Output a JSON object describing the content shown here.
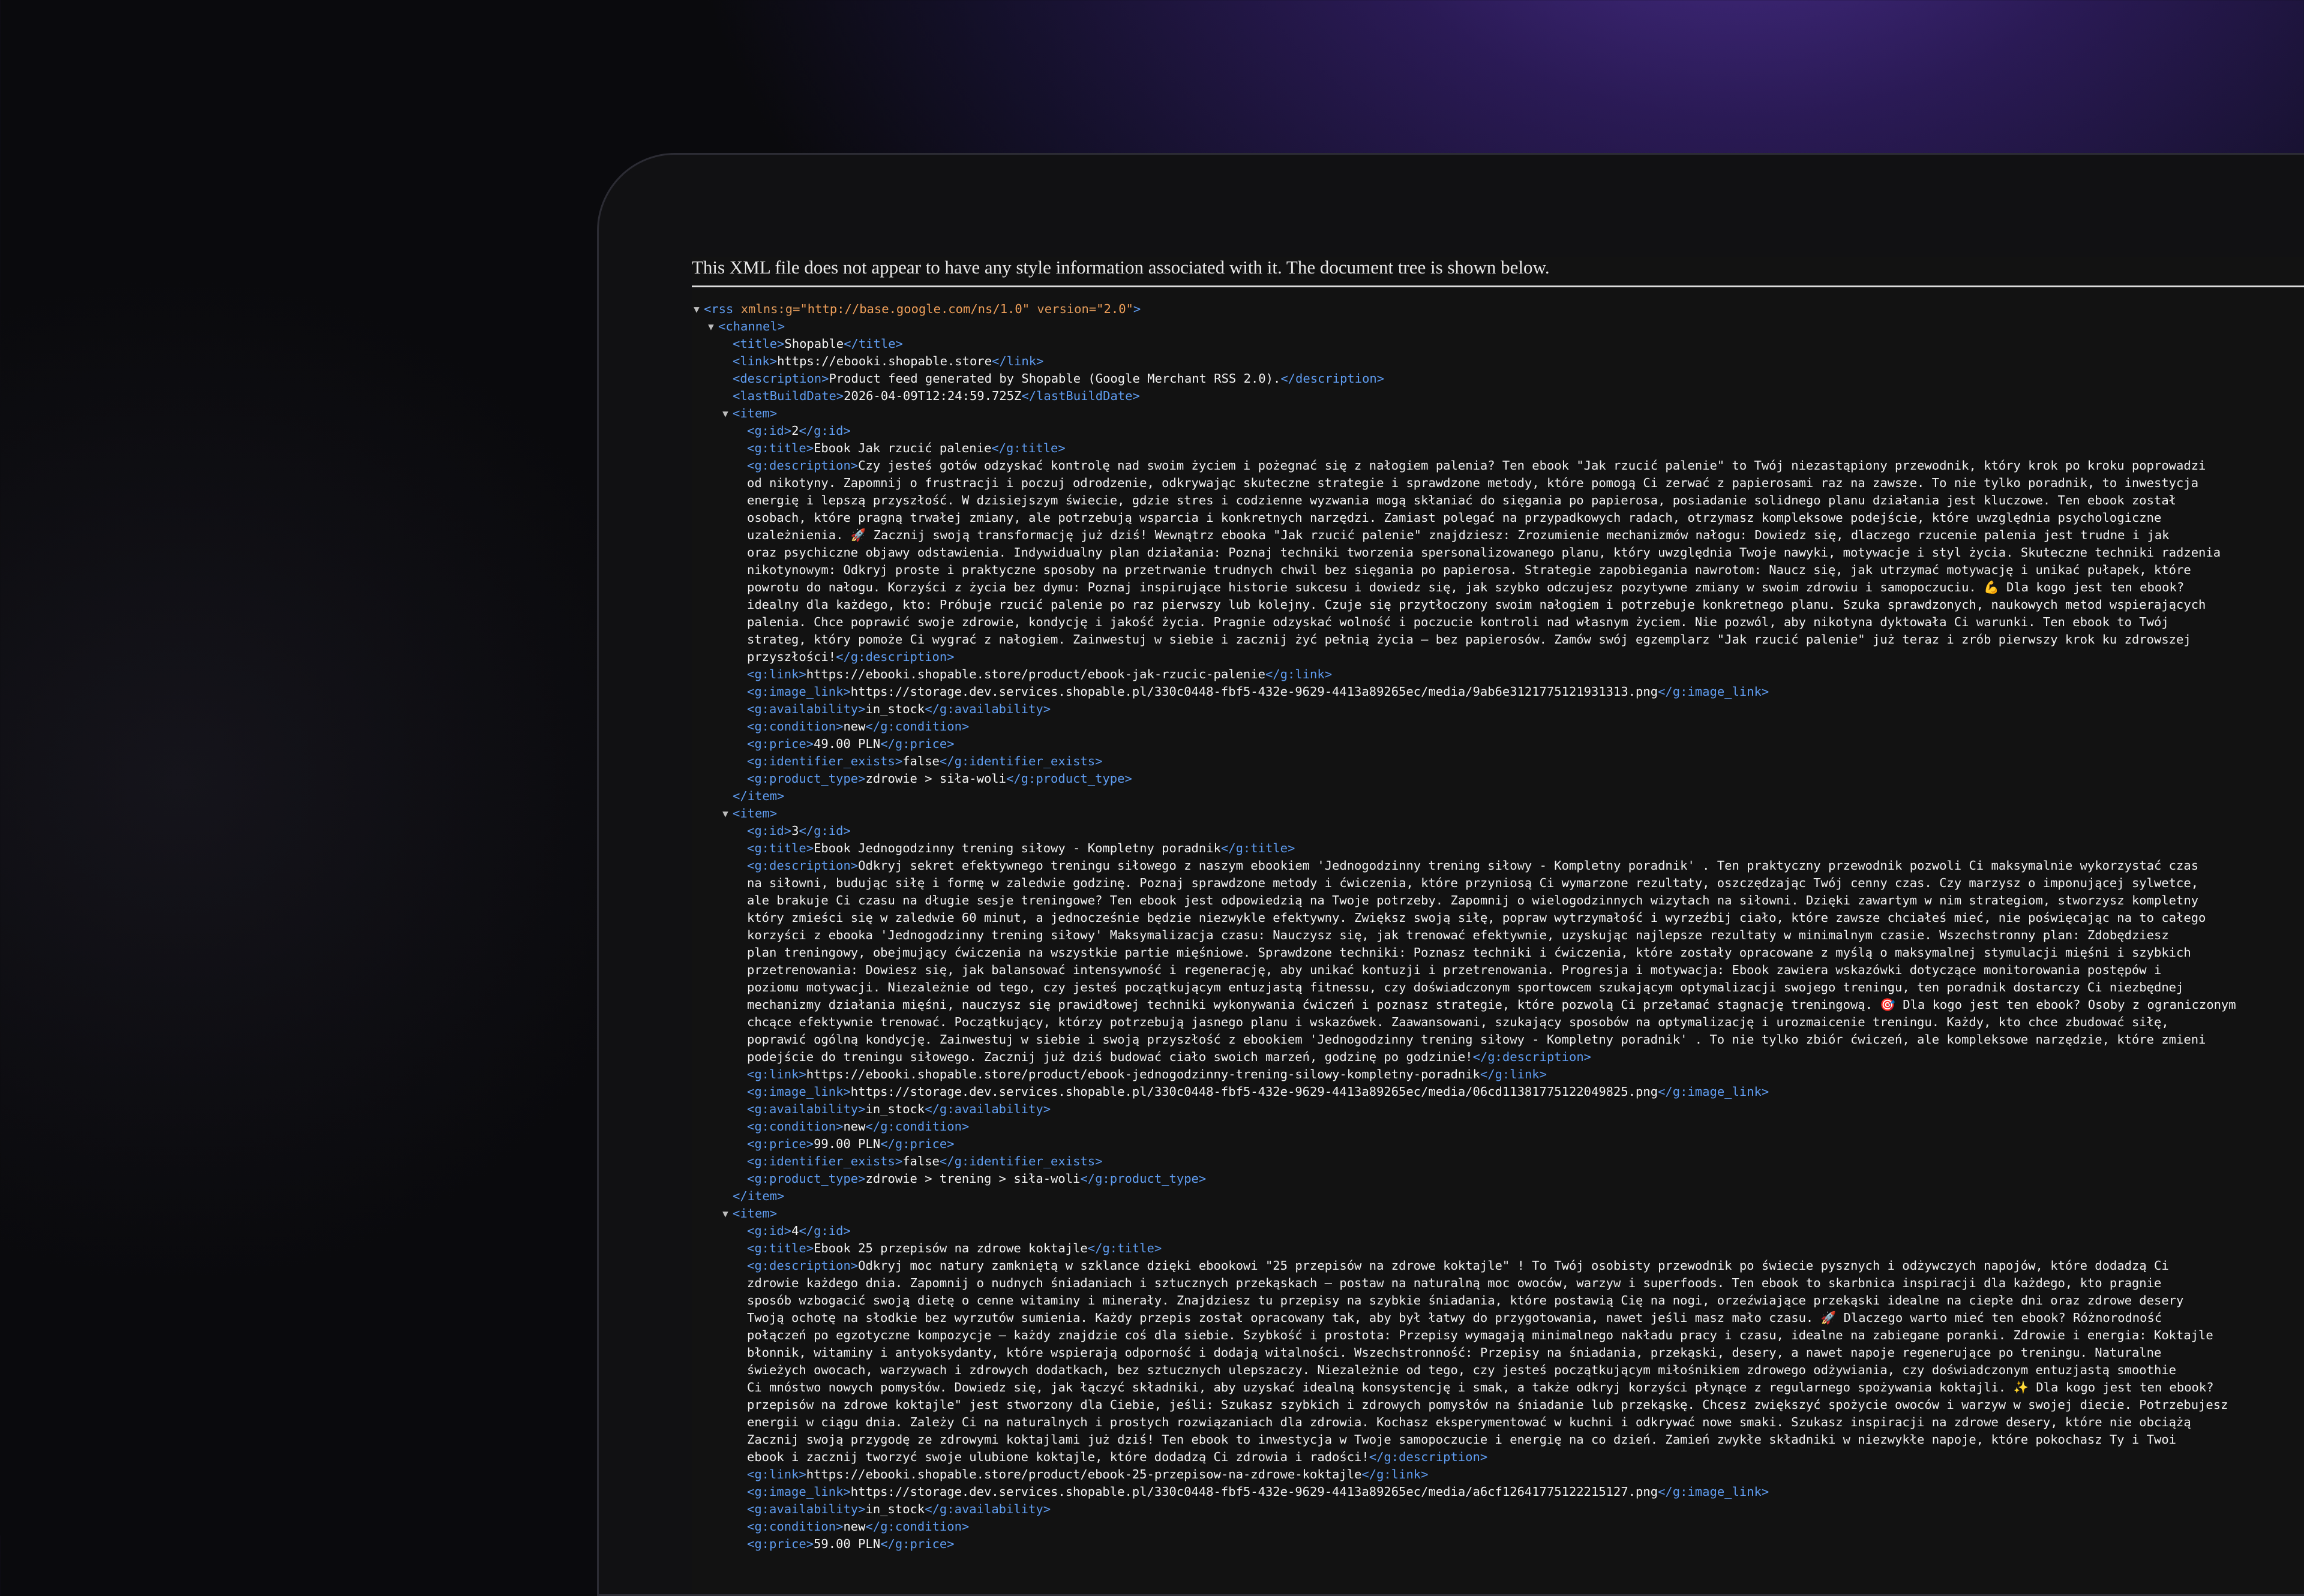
{
  "banner": "This XML file does not appear to have any style information associated with it. The document tree is shown below.",
  "rss": {
    "open": "<rss xmlns:g=\"http://base.google.com/ns/1.0\" version=\"2.0\">",
    "channel_open": "<channel>",
    "title": "Shopable",
    "link": "https://ebooki.shopable.store",
    "description": "Product feed generated by Shopable (Google Merchant RSS 2.0).",
    "lastBuildDate": "2026-04-09T12:24:59.725Z"
  },
  "items": [
    {
      "id": "2",
      "title": "Ebook Jak rzucić palenie",
      "description_lines": [
        "Czy jesteś gotów odzyskać kontrolę nad swoim życiem i pożegnać się z nałogiem palenia? Ten ebook \"Jak rzucić palenie\" to Twój niezastąpiony przewodnik, który krok po kroku poprowadzi",
        "od nikotyny. Zapomnij o frustracji i poczuj odrodzenie, odkrywając skuteczne strategie i sprawdzone metody, które pomogą Ci zerwać z papierosami raz na zawsze. To nie tylko poradnik, to inwestycja",
        "energię i lepszą przyszłość. W dzisiejszym świecie, gdzie stres i codzienne wyzwania mogą skłaniać do sięgania po papierosa, posiadanie solidnego planu działania jest kluczowe. Ten ebook został",
        "osobach, które pragną trwałej zmiany, ale potrzebują wsparcia i konkretnych narzędzi. Zamiast polegać na przypadkowych radach, otrzymasz kompleksowe podejście, które uwzględnia psychologiczne",
        "uzależnienia. 🚀 Zacznij swoją transformację już dziś! Wewnątrz ebooka \"Jak rzucić palenie\" znajdziesz: Zrozumienie mechanizmów nałogu: Dowiedz się, dlaczego rzucenie palenia jest trudne i jak",
        "oraz psychiczne objawy odstawienia. Indywidualny plan działania: Poznaj techniki tworzenia spersonalizowanego planu, który uwzględnia Twoje nawyki, motywacje i styl życia. Skuteczne techniki radzenia",
        "nikotynowym: Odkryj proste i praktyczne sposoby na przetrwanie trudnych chwil bez sięgania po papierosa. Strategie zapobiegania nawrotom: Naucz się, jak utrzymać motywację i unikać pułapek, które",
        "powrotu do nałogu. Korzyści z życia bez dymu: Poznaj inspirujące historie sukcesu i dowiedz się, jak szybko odczujesz pozytywne zmiany w swoim zdrowiu i samopoczuciu. 💪 Dla kogo jest ten ebook?",
        "idealny dla każdego, kto: Próbuje rzucić palenie po raz pierwszy lub kolejny. Czuje się przytłoczony swoim nałogiem i potrzebuje konkretnego planu. Szuka sprawdzonych, naukowych metod wspierających",
        "palenia. Chce poprawić swoje zdrowie, kondycję i jakość życia. Pragnie odzyskać wolność i poczucie kontroli nad własnym życiem. Nie pozwól, aby nikotyna dyktowała Ci warunki. Ten ebook to Twój",
        "strateg, który pomoże Ci wygrać z nałogiem. Zainwestuj w siebie i zacznij żyć pełnią życia – bez papierosów. Zamów swój egzemplarz \"Jak rzucić palenie\" już teraz i zrób pierwszy krok ku zdrowszej",
        "przyszłości!"
      ],
      "link": "https://ebooki.shopable.store/product/ebook-jak-rzucic-palenie",
      "image_link": "https://storage.dev.services.shopable.pl/330c0448-fbf5-432e-9629-4413a89265ec/media/9ab6e3121775121931313.png",
      "availability": "in_stock",
      "condition": "new",
      "price": "49.00 PLN",
      "identifier_exists": "false",
      "product_type": "zdrowie > siła-woli"
    },
    {
      "id": "3",
      "title": "Ebook Jednogodzinny trening siłowy - Kompletny poradnik",
      "description_lines": [
        "Odkryj sekret efektywnego treningu siłowego z naszym ebookiem 'Jednogodzinny trening siłowy - Kompletny poradnik' . Ten praktyczny przewodnik pozwoli Ci maksymalnie wykorzystać czas",
        "na siłowni, budując siłę i formę w zaledwie godzinę. Poznaj sprawdzone metody i ćwiczenia, które przyniosą Ci wymarzone rezultaty, oszczędzając Twój cenny czas. Czy marzysz o imponującej sylwetce,",
        "ale brakuje Ci czasu na długie sesje treningowe? Ten ebook jest odpowiedzią na Twoje potrzeby. Zapomnij o wielogodzinnych wizytach na siłowni. Dzięki zawartym w nim strategiom, stworzysz kompletny",
        "który zmieści się w zaledwie 60 minut, a jednocześnie będzie niezwykle efektywny. Zwiększ swoją siłę, popraw wytrzymałość i wyrzeźbij ciało, które zawsze chciałeś mieć, nie poświęcając na to całego",
        "korzyści z ebooka 'Jednogodzinny trening siłowy' Maksymalizacja czasu: Nauczysz się, jak trenować efektywnie, uzyskując najlepsze rezultaty w minimalnym czasie. Wszechstronny plan: Zdobędziesz",
        "plan treningowy, obejmujący ćwiczenia na wszystkie partie mięśniowe. Sprawdzone techniki: Poznasz techniki i ćwiczenia, które zostały opracowane z myślą o maksymalnej stymulacji mięśni i szybkich",
        "przetrenowania: Dowiesz się, jak balansować intensywność i regenerację, aby unikać kontuzji i przetrenowania. Progresja i motywacja: Ebook zawiera wskazówki dotyczące monitorowania postępów i",
        "poziomu motywacji. Niezależnie od tego, czy jesteś początkującym entuzjastą fitnessu, czy doświadczonym sportowcem szukającym optymalizacji swojego treningu, ten poradnik dostarczy Ci niezbędnej",
        "mechanizmy działania mięśni, nauczysz się prawidłowej techniki wykonywania ćwiczeń i poznasz strategie, które pozwolą Ci przełamać stagnację treningową. 🎯 Dla kogo jest ten ebook? Osoby z ograniczonym",
        "chcące efektywnie trenować. Początkujący, którzy potrzebują jasnego planu i wskazówek. Zaawansowani, szukający sposobów na optymalizację i urozmaicenie treningu. Każdy, kto chce zbudować siłę,",
        "poprawić ogólną kondycję. Zainwestuj w siebie i swoją przyszłość z ebookiem 'Jednogodzinny trening siłowy - Kompletny poradnik' . To nie tylko zbiór ćwiczeń, ale kompleksowe narzędzie, które zmieni",
        "podejście do treningu siłowego. Zacznij już dziś budować ciało swoich marzeń, godzinę po godzinie!"
      ],
      "link": "https://ebooki.shopable.store/product/ebook-jednogodzinny-trening-silowy-kompletny-poradnik",
      "image_link": "https://storage.dev.services.shopable.pl/330c0448-fbf5-432e-9629-4413a89265ec/media/06cd11381775122049825.png",
      "availability": "in_stock",
      "condition": "new",
      "price": "99.00 PLN",
      "identifier_exists": "false",
      "product_type": "zdrowie > trening > siła-woli"
    },
    {
      "id": "4",
      "title": "Ebook 25 przepisów na zdrowe koktajle",
      "description_lines": [
        "Odkryj moc natury zamkniętą w szklance dzięki ebookowi \"25 przepisów na zdrowe koktajle\" ! To Twój osobisty przewodnik po świecie pysznych i odżywczych napojów, które dodadzą Ci",
        "zdrowie każdego dnia. Zapomnij o nudnych śniadaniach i sztucznych przekąskach – postaw na naturalną moc owoców, warzyw i superfoods. Ten ebook to skarbnica inspiracji dla każdego, kto pragnie",
        "sposób wzbogacić swoją dietę o cenne witaminy i minerały. Znajdziesz tu przepisy na szybkie śniadania, które postawią Cię na nogi, orzeźwiające przekąski idealne na ciepłe dni oraz zdrowe desery",
        "Twoją ochotę na słodkie bez wyrzutów sumienia. Każdy przepis został opracowany tak, aby był łatwy do przygotowania, nawet jeśli masz mało czasu. 🚀 Dlaczego warto mieć ten ebook? Różnorodność",
        "połączeń po egzotyczne kompozycje – każdy znajdzie coś dla siebie. Szybkość i prostota: Przepisy wymagają minimalnego nakładu pracy i czasu, idealne na zabiegane poranki. Zdrowie i energia: Koktajle",
        "błonnik, witaminy i antyoksydanty, które wspierają odporność i dodają witalności. Wszechstronność: Przepisy na śniadania, przekąski, desery, a nawet napoje regenerujące po treningu. Naturalne",
        "świeżych owocach, warzywach i zdrowych dodatkach, bez sztucznych ulepszaczy. Niezależnie od tego, czy jesteś początkującym miłośnikiem zdrowego odżywiania, czy doświadczonym entuzjastą smoothie",
        "Ci mnóstwo nowych pomysłów. Dowiedz się, jak łączyć składniki, aby uzyskać idealną konsystencję i smak, a także odkryj korzyści płynące z regularnego spożywania koktajli. ✨ Dla kogo jest ten ebook?",
        "przepisów na zdrowe koktajle\" jest stworzony dla Ciebie, jeśli: Szukasz szybkich i zdrowych pomysłów na śniadanie lub przekąskę. Chcesz zwiększyć spożycie owoców i warzyw w swojej diecie. Potrzebujesz",
        "energii w ciągu dnia. Zależy Ci na naturalnych i prostych rozwiązaniach dla zdrowia. Kochasz eksperymentować w kuchni i odkrywać nowe smaki. Szukasz inspiracji na zdrowe desery, które nie obciążą",
        "Zacznij swoją przygodę ze zdrowymi koktajlami już dziś! Ten ebook to inwestycja w Twoje samopoczucie i energię na co dzień. Zamień zwykłe składniki w niezwykłe napoje, które pokochasz Ty i Twoi",
        "ebook i zacznij tworzyć swoje ulubione koktajle, które dodadzą Ci zdrowia i radości!"
      ],
      "link": "https://ebooki.shopable.store/product/ebook-25-przepisow-na-zdrowe-koktajle",
      "image_link": "https://storage.dev.services.shopable.pl/330c0448-fbf5-432e-9629-4413a89265ec/media/a6cf12641775122215127.png",
      "availability": "in_stock",
      "condition": "new",
      "price": "59.00 PLN"
    }
  ]
}
